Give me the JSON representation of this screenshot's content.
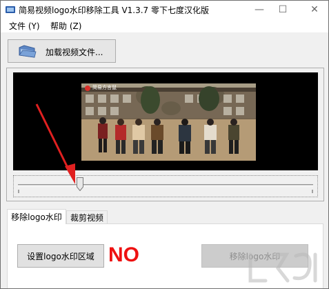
{
  "window": {
    "title": "简易视频logo水印移除工具 V1.3.7 零下七度汉化版",
    "controls": {
      "minimize": "—",
      "maximize": "☐",
      "close": "✕"
    }
  },
  "menu": {
    "items": [
      {
        "label": "文件 (Y)"
      },
      {
        "label": "帮助 (Z)"
      }
    ]
  },
  "toolbar": {
    "load_label": "加载视频文件...",
    "load_icon": "folder-icon"
  },
  "preview": {
    "watermark_text": "简易方言鼠",
    "slider_position": 0.21
  },
  "tabs": [
    {
      "label": "移除logo水印",
      "active": true
    },
    {
      "label": "裁剪视频",
      "active": false
    }
  ],
  "remove_tab": {
    "set_region_label": "设置logo水印区域",
    "annotation": "NO",
    "remove_label": "移除logo水印",
    "remove_enabled": false
  },
  "colors": {
    "annotation": "#ee1111",
    "arrow": "#e02020"
  }
}
